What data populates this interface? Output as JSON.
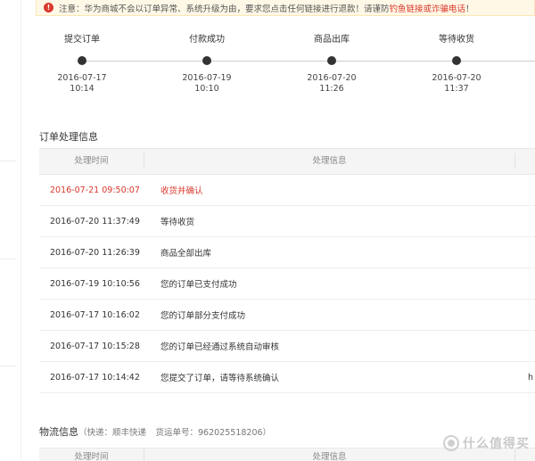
{
  "notice": {
    "text": "注意：华为商城不会以订单异常、系统升级为由，要求您点击任何链接进行退款！请谨防",
    "link": "钓鱼链接或诈骗电话",
    "tail": "！"
  },
  "timeline": {
    "steps": [
      {
        "label": "提交订单",
        "date": "2016-07-17",
        "time": "10:14"
      },
      {
        "label": "付款成功",
        "date": "2016-07-19",
        "time": "10:10"
      },
      {
        "label": "商品出库",
        "date": "2016-07-20",
        "time": "11:26"
      },
      {
        "label": "等待收货",
        "date": "2016-07-20",
        "time": "11:37"
      }
    ]
  },
  "order_section": {
    "title": "订单处理信息",
    "headers": {
      "time": "处理时间",
      "info": "处理信息"
    },
    "rows": [
      {
        "time": "2016-07-21 09:50:07",
        "info": "收货并确认",
        "highlight": true
      },
      {
        "time": "2016-07-20 11:37:49",
        "info": "等待收货"
      },
      {
        "time": "2016-07-20 11:26:39",
        "info": "商品全部出库"
      },
      {
        "time": "2016-07-19 10:10:56",
        "info": "您的订单已支付成功"
      },
      {
        "time": "2016-07-17 10:16:02",
        "info": "您的订单部分支付成功"
      },
      {
        "time": "2016-07-17 10:15:28",
        "info": "您的订单已经通过系统自动审核"
      },
      {
        "time": "2016-07-17 10:14:42",
        "info": "您提交了订单，请等待系统确认",
        "edge": "h"
      }
    ]
  },
  "logistics_section": {
    "title": "物流信息",
    "express": "（快递：顺丰快递",
    "tracking": "货运单号：962025518206）",
    "headers": {
      "time": "处理时间",
      "info": "处理信息"
    }
  },
  "watermark": {
    "text": "什么值得买"
  },
  "colors": {
    "accent_red": "#d9392d",
    "notice_bg": "#fff8e7"
  }
}
